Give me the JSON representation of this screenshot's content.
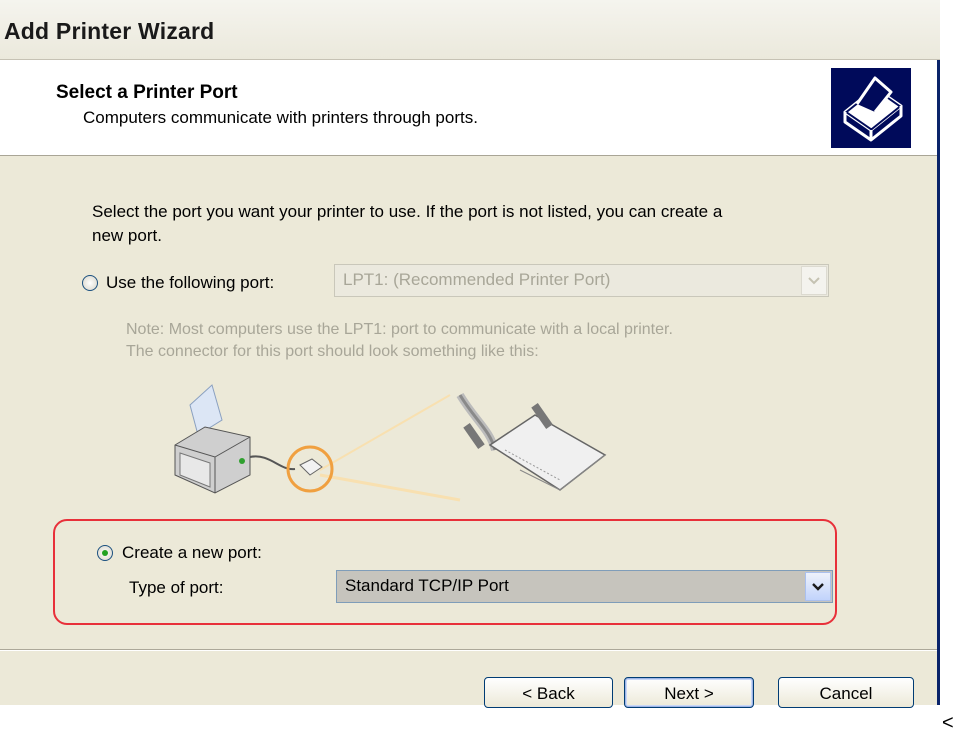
{
  "window": {
    "title": "Add Printer Wizard"
  },
  "header": {
    "title": "Select a Printer Port",
    "subtitle": "Computers communicate with printers through ports."
  },
  "content": {
    "intro_line1": "Select the port you want your printer to use.  If the port is not listed, you can create a",
    "intro_line2": "new port.",
    "use_following_port": {
      "label": "Use the following port:",
      "selected": false,
      "value": "LPT1: (Recommended Printer Port)"
    },
    "note_line1": "Note: Most computers use the LPT1: port to communicate with a local printer.",
    "note_line2": "The connector for this port should look something like this:",
    "create_new_port": {
      "label": "Create a new port:",
      "selected": true,
      "type_label": "Type of port:",
      "type_value": "Standard TCP/IP Port"
    }
  },
  "buttons": {
    "back": "< Back",
    "next": "Next >",
    "cancel": "Cancel"
  },
  "trailing_glyph": "<",
  "colors": {
    "highlight_border": "#e8303a",
    "header_icon_bg": "#000a5a",
    "dialog_bg": "#ece9d8"
  }
}
